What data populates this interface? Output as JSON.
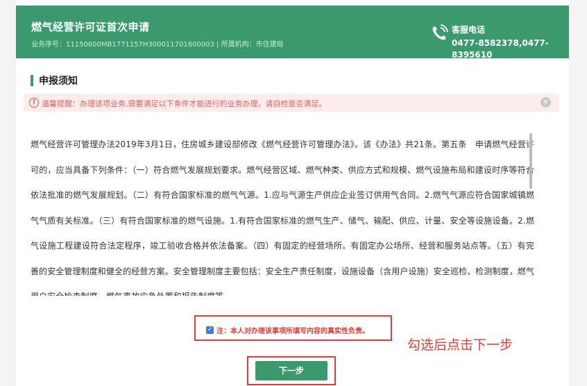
{
  "header": {
    "title": "燃气经营许可证首次申请",
    "subtitle": "业务序号：11150600MB1771157H300011701800003 | 所属机构：市住建局",
    "service_label": "客服电话",
    "service_phone": "0477-8582378,0477-8395610"
  },
  "section": {
    "title": "申报须知"
  },
  "notice": {
    "text": "温馨提醒：办理该项业务,需要满足以下条件才能进行的业务办理，请自检是否满足。"
  },
  "content": {
    "text": "燃气经营许可管理办法2019年3月1日，住房城乡建设部修改《燃气经营许可管理办法》。该《办法》共21条。第五条　申请燃气经营许可的，应当具备下列条件：（一）符合燃气发展规划要求。燃气经营区域、燃气种类、供应方式和规模、燃气设施布局和建设时序等符合依法批准的燃气发展规划。（二）有符合国家标准的燃气气源。1.应与气源生产供应企业签订供用气合同。2.燃气气源应符合国家城镇燃气气质有关标准。（三）有符合国家标准的燃气设施。1.有符合国家标准的燃气生产、储气、输配、供应、计量、安全等设施设备。2.燃气设施工程建设符合法定程序，竣工验收合格并依法备案。（四）有固定的经营场所。有固定办公场所、经营和服务站点等。（五）有完善的安全管理制度和健全的经营方案。安全管理制度主要包括：安全生产责任制度，设施设备（含用户设施）安全巡检、检测制度，燃气用户安全检查制度，燃气事故应急处置和报告制度等。"
  },
  "confirm": {
    "checked": true,
    "text": "注：本人对办理该事项所填写内容的真实性负责。"
  },
  "annotation": {
    "text": "勾选后点击下一步"
  },
  "actions": {
    "next_label": "下一步"
  },
  "colors": {
    "brand": "#3a9a6e",
    "alert": "#e53935",
    "notice_bg": "#fdecec",
    "checkbox": "#3b7bd9"
  },
  "icons": {
    "phone": "phone-icon",
    "warning": "warning-icon",
    "close": "close-icon",
    "check": "checkbox-checked-icon"
  }
}
